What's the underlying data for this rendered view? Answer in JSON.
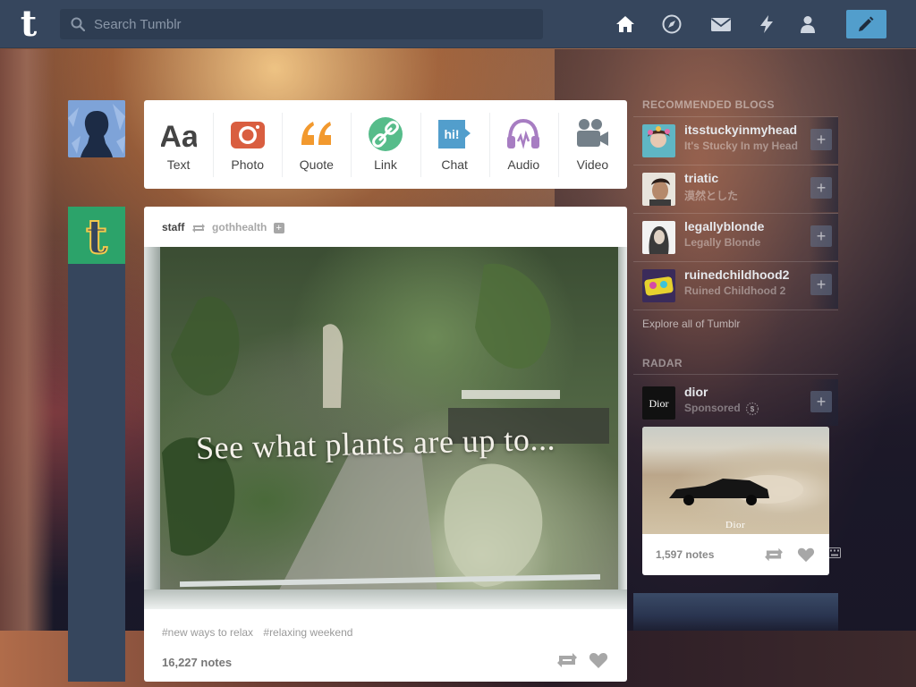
{
  "header": {
    "logo": "t",
    "search_placeholder": "Search Tumblr"
  },
  "post_types": [
    {
      "label": "Text",
      "icon": "text-icon",
      "color": "#444444"
    },
    {
      "label": "Photo",
      "icon": "camera-icon",
      "color": "#d95e40"
    },
    {
      "label": "Quote",
      "icon": "quote-icon",
      "color": "#f2992e"
    },
    {
      "label": "Link",
      "icon": "link-icon",
      "color": "#56bc8a"
    },
    {
      "label": "Chat",
      "icon": "chat-icon",
      "color": "#529ecc"
    },
    {
      "label": "Audio",
      "icon": "headphones-icon",
      "color": "#a77dc2"
    },
    {
      "label": "Video",
      "icon": "video-camera-icon",
      "color": "#748089"
    }
  ],
  "post": {
    "author": "staff",
    "source": "gothhealth",
    "photo_caption": "See what plants are up to...",
    "tags": [
      "#new ways to relax",
      "#relaxing weekend"
    ],
    "notes": "16,227 notes"
  },
  "sidebar": {
    "recommended_heading": "RECOMMENDED BLOGS",
    "blogs": [
      {
        "name": "itsstuckyinmyhead",
        "title": "It's Stucky In my Head"
      },
      {
        "name": "triatic",
        "title": "漠然とした"
      },
      {
        "name": "legallyblonde",
        "title": "Legally Blonde"
      },
      {
        "name": "ruinedchildhood2",
        "title": "Ruined Childhood 2"
      }
    ],
    "explore_link": "Explore all of Tumblr",
    "radar_heading": "RADAR",
    "radar": {
      "name": "dior",
      "subtitle": "Sponsored",
      "brand_logo_text": "Dior",
      "photo_brand": "Dior",
      "notes": "1,597 notes"
    }
  },
  "colors": {
    "topbar": "#36465d",
    "accent_blue": "#529ecc",
    "staff_green": "#2ca36a"
  }
}
